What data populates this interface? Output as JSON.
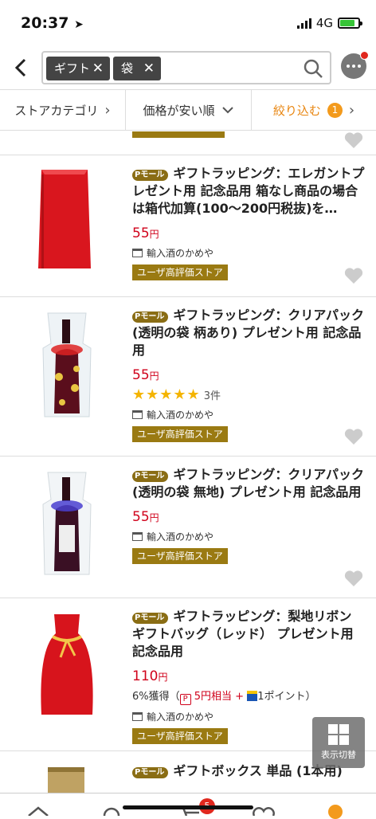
{
  "status": {
    "time": "20:37",
    "network": "4G"
  },
  "search": {
    "chips": [
      {
        "label": "ギフト"
      },
      {
        "label": "袋"
      }
    ]
  },
  "filters": {
    "category": "ストアカテゴリ",
    "sort": "価格が安い順",
    "refine": "絞り込む",
    "refine_count": "1"
  },
  "items": [
    {
      "badge": "Pモール",
      "title": "ギフトラッピング：エレガントプレゼント用 記念品用 箱なし商品の場合は箱代加算(100～200円税抜)を…",
      "price": "55",
      "price_unit": "円",
      "shop": "輸入酒のかめや",
      "store_badge": "ユーザ高評価ストア"
    },
    {
      "badge": "Pモール",
      "title": "ギフトラッピング：クリアパック (透明の袋 柄あり) プレゼント用 記念品用",
      "price": "55",
      "price_unit": "円",
      "rating_stars": "★★★★★",
      "rating_value": 5,
      "reviews": "3件",
      "shop": "輸入酒のかめや",
      "store_badge": "ユーザ高評価ストア"
    },
    {
      "badge": "Pモール",
      "title": "ギフトラッピング：クリアパック (透明の袋 無地) プレゼント用 記念品用",
      "price": "55",
      "price_unit": "円",
      "shop": "輸入酒のかめや",
      "store_badge": "ユーザ高評価ストア"
    },
    {
      "badge": "Pモール",
      "title": "ギフトラッピング：梨地リボン ギフトバッグ（レッド） プレゼント用 記念品用",
      "price": "110",
      "price_unit": "円",
      "points_earn": "6%獲得",
      "points_open": "（",
      "points_p": "P",
      "points_p_text": "5円相当 +",
      "points_t_text": "1ポイント）",
      "shop": "輸入酒のかめや",
      "store_badge": "ユーザ高評価ストア"
    },
    {
      "badge": "Pモール",
      "title": "ギフトボックス 単品 (1本用)"
    }
  ],
  "toggle_view": {
    "label": "表示切替"
  },
  "cart_count": "5",
  "colors": {
    "price": "#d0021b",
    "store_badge": "#9a7a12",
    "accent": "#f39a1c"
  }
}
